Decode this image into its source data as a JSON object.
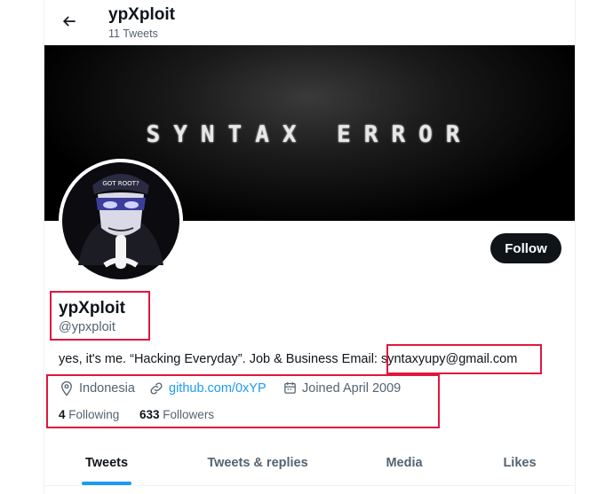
{
  "header": {
    "title": "ypXploit",
    "subtitle": "11 Tweets",
    "back_icon": "arrow-left-icon"
  },
  "banner": {
    "text": "SYNTAX ERROR"
  },
  "avatar": {
    "cap_text": "GOT ROOT?"
  },
  "profile": {
    "follow_label": "Follow",
    "display_name": "ypXploit",
    "handle": "@ypxploit",
    "bio_prefix": "yes, it's me. “Hacking Everyday”. Job & Business Email:",
    "bio_email": "syntaxyupy@gmail.com",
    "location": "Indonesia",
    "website": "github.com/0xYP",
    "joined": "Joined April 2009",
    "following_count": "4",
    "following_label": "Following",
    "followers_count": "633",
    "followers_label": "Followers"
  },
  "tabs": [
    {
      "label": "Tweets",
      "active": true
    },
    {
      "label": "Tweets & replies",
      "active": false
    },
    {
      "label": "Media",
      "active": false
    },
    {
      "label": "Likes",
      "active": false
    }
  ],
  "colors": {
    "accent": "#1d9bf0",
    "highlight_box": "#e0173c",
    "text_primary": "#0f1419",
    "text_secondary": "#536471"
  }
}
